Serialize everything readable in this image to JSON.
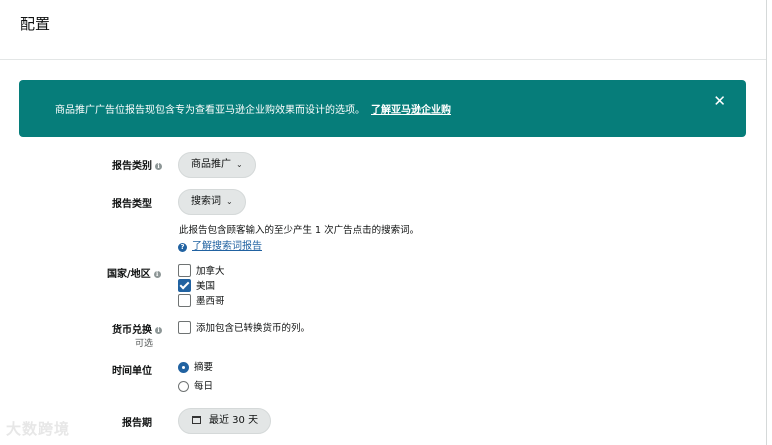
{
  "header": {
    "title": "配置"
  },
  "banner": {
    "text": "商品推广广告位报告现包含专为查看亚马逊企业购效果而设计的选项。",
    "link": "了解亚马逊企业购",
    "close": "✕"
  },
  "report_category": {
    "label": "报告类别",
    "value": "商品推广"
  },
  "report_type": {
    "label": "报告类型",
    "value": "搜索词",
    "description": "此报告包含顾客输入的至少产生 1 次广告点击的搜索词。",
    "help_link": "了解搜索词报告"
  },
  "country": {
    "label": "国家/地区",
    "options": [
      {
        "label": "加拿大",
        "checked": false
      },
      {
        "label": "美国",
        "checked": true
      },
      {
        "label": "墨西哥",
        "checked": false
      }
    ]
  },
  "currency": {
    "label": "货币兑换",
    "optional": "可选",
    "option": {
      "label": "添加包含已转换货币的列。",
      "checked": false
    }
  },
  "time_unit": {
    "label": "时间单位",
    "options": [
      {
        "label": "摘要",
        "checked": true
      },
      {
        "label": "每日",
        "checked": false
      }
    ]
  },
  "report_period": {
    "label": "报告期",
    "value": "最近 30 天"
  },
  "watermark": "大数跨境"
}
